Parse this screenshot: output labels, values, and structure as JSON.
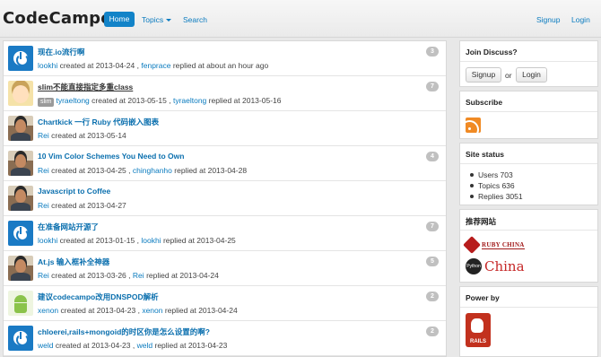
{
  "navbar": {
    "brand": "CodeCampo",
    "home": "Home",
    "topics": "Topics",
    "search": "Search",
    "signup": "Signup",
    "login": "Login"
  },
  "topics": [
    {
      "avatar": "power-icon-avatar",
      "title": "现在.io流行啊",
      "visited": false,
      "node": "",
      "author": "lookhi",
      "created": "created at 2013-04-24",
      "sep": ",",
      "replier": "fenprace",
      "replied": "replied at about an hour ago",
      "count": "3"
    },
    {
      "avatar": "cartoon-avatar",
      "title": "slim不能直接指定多重class",
      "visited": true,
      "node": "slim",
      "author": "tyraeltong",
      "created": "created at 2013-05-15",
      "sep": ",",
      "replier": "tyraeltong",
      "replied": "replied at 2013-05-16",
      "count": "7"
    },
    {
      "avatar": "man-avatar",
      "title": "Chartkick 一行 Ruby 代码嵌入图表",
      "visited": false,
      "node": "",
      "author": "Rei",
      "created": "created at 2013-05-14",
      "sep": "",
      "replier": "",
      "replied": "",
      "count": ""
    },
    {
      "avatar": "man-avatar",
      "title": "10 Vim Color Schemes You Need to Own",
      "visited": false,
      "node": "",
      "author": "Rei",
      "created": "created at 2013-04-25",
      "sep": ",",
      "replier": "chinghanho",
      "replied": "replied at 2013-04-28",
      "count": "4"
    },
    {
      "avatar": "man-avatar",
      "title": "Javascript to Coffee",
      "visited": false,
      "node": "",
      "author": "Rei",
      "created": "created at 2013-04-27",
      "sep": "",
      "replier": "",
      "replied": "",
      "count": ""
    },
    {
      "avatar": "power-icon-avatar",
      "title": "在准备网站开源了",
      "visited": false,
      "node": "",
      "author": "lookhi",
      "created": "created at 2013-01-15",
      "sep": ",",
      "replier": "lookhi",
      "replied": "replied at 2013-04-25",
      "count": "7"
    },
    {
      "avatar": "man-avatar",
      "title": "At.js 输入框补全神器",
      "visited": false,
      "node": "",
      "author": "Rei",
      "created": "created at 2013-03-26",
      "sep": ",",
      "replier": "Rei",
      "replied": "replied at 2013-04-24",
      "count": "5"
    },
    {
      "avatar": "android-avatar",
      "title": "建议codecampo改用DNSPOD解析",
      "visited": false,
      "node": "",
      "author": "xenon",
      "created": "created at 2013-04-23",
      "sep": ",",
      "replier": "xenon",
      "replied": "replied at 2013-04-24",
      "count": "2"
    },
    {
      "avatar": "power-icon-avatar",
      "title": "chloerei,rails+mongoid的时区你是怎么设置的啊?",
      "visited": false,
      "node": "",
      "author": "weld",
      "created": "created at 2013-04-23",
      "sep": ",",
      "replier": "weld",
      "replied": "replied at 2013-04-23",
      "count": "2"
    }
  ],
  "sidebar": {
    "join": {
      "title": "Join Discuss?",
      "signup": "Signup",
      "or": "or",
      "login": "Login"
    },
    "subscribe": {
      "title": "Subscribe"
    },
    "status": {
      "title": "Site status",
      "users": "Users 703",
      "topics": "Topics 636",
      "replies": "Replies 3051"
    },
    "links": {
      "title": "推荐网站",
      "ruby_china": "RUBY CHINA",
      "python_china": "China",
      "python_badge": "Python"
    },
    "power": {
      "title": "Power by",
      "rails": "RAILS"
    }
  }
}
